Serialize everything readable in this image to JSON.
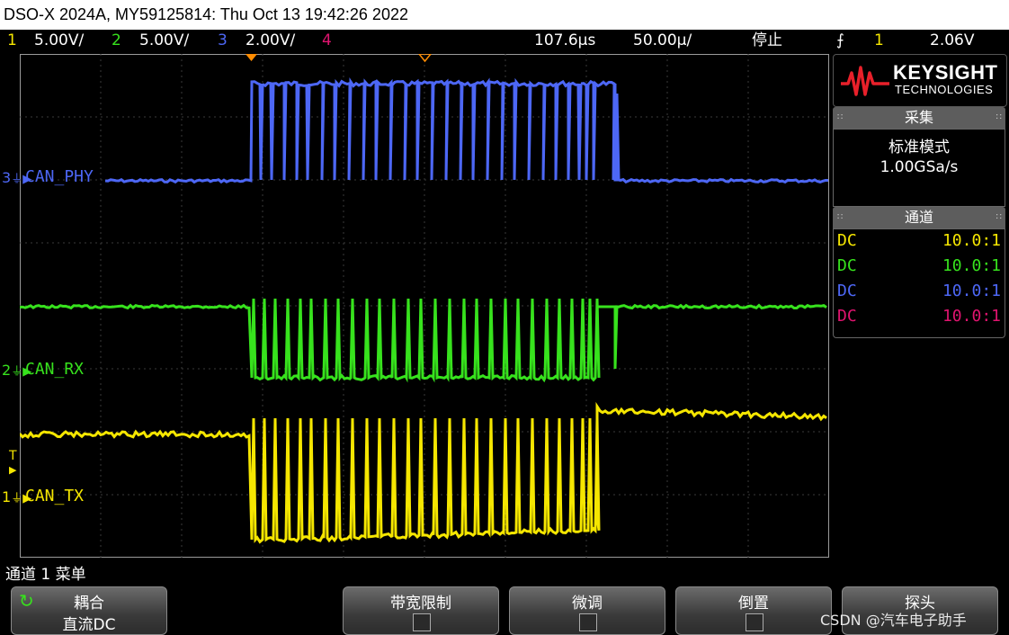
{
  "title": "DSO-X 2024A, MY59125814: Thu Oct 13 19:42:26 2022",
  "status": {
    "ch1_num": "1",
    "ch1_scale": "5.00V/",
    "ch2_num": "2",
    "ch2_scale": "5.00V/",
    "ch3_num": "3",
    "ch3_scale": "2.00V/",
    "ch4_num": "4",
    "time_delay": "107.6µs",
    "time_scale": "50.00µ/",
    "run_state": "停止",
    "trigger_source": "1",
    "trigger_level": "2.06V"
  },
  "channels": {
    "ch3_label": "CAN_PHY",
    "ch3_marker": "3",
    "ch2_label": "CAN_RX",
    "ch2_marker": "2",
    "ch1_label": "CAN_TX",
    "ch1_marker": "1",
    "trigger_marker": "T"
  },
  "logo": {
    "brand": "KEYSIGHT",
    "sub": "TECHNOLOGIES"
  },
  "acquisition": {
    "header": "采集",
    "mode": "标准模式",
    "rate": "1.00GSa/s"
  },
  "channel_panel": {
    "header": "通道",
    "rows": [
      {
        "coupling": "DC",
        "probe": "10.0:1",
        "color": "#f5e600"
      },
      {
        "coupling": "DC",
        "probe": "10.0:1",
        "color": "#37e21d"
      },
      {
        "coupling": "DC",
        "probe": "10.0:1",
        "color": "#4d67f5"
      },
      {
        "coupling": "DC",
        "probe": "10.0:1",
        "color": "#e0146f"
      }
    ]
  },
  "menu": {
    "title": "通道 1 菜单",
    "softkeys": [
      {
        "label": "耦合",
        "value": "直流DC"
      },
      {
        "label": "带宽限制"
      },
      {
        "label": "微调"
      },
      {
        "label": "倒置"
      },
      {
        "label": "探头"
      }
    ]
  },
  "watermark": "CSDN @汽车电子助手",
  "colors": {
    "ch1": "#f5e600",
    "ch2": "#37e21d",
    "ch3": "#4d67f5",
    "ch4": "#e0146f",
    "marker": "#ff8c00"
  }
}
